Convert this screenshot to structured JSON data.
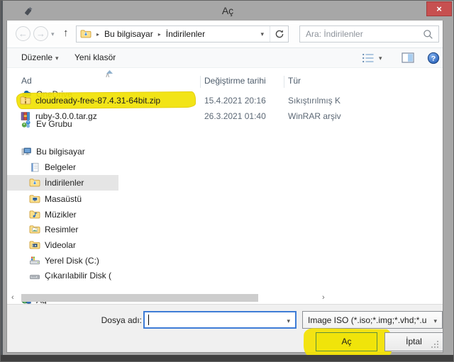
{
  "window": {
    "title": "Aç"
  },
  "icons": {
    "close": "×",
    "back": "←",
    "forward": "→",
    "up": "↑",
    "dropdown": "▾",
    "breadcrumb_sep": "▸",
    "scroll_up": "∧",
    "scroll_down": "∨",
    "scroll_left": "‹",
    "scroll_right": "›",
    "titlebar_icon": "usb-drive",
    "refresh": "refresh-arrow",
    "search": "magnifier",
    "help": "question-mark",
    "views": "list-view",
    "preview": "preview-pane"
  },
  "nav": {
    "breadcrumb": {
      "segments": [
        "Bu bilgisayar",
        "İndirilenler"
      ]
    },
    "search": {
      "placeholder": "Ara: İndirilenler"
    }
  },
  "toolbar": {
    "organize": "Düzenle",
    "new_folder": "Yeni klasör"
  },
  "sidebar": {
    "items": [
      {
        "label": "OneDrive",
        "icon": "onedrive-cloud",
        "level": 0,
        "selected": false
      },
      {
        "label": "Ev Grubu",
        "icon": "homegroup",
        "level": 0,
        "selected": false
      },
      {
        "label": "Bu bilgisayar",
        "icon": "computer",
        "level": 0,
        "selected": false
      },
      {
        "label": "Belgeler",
        "icon": "documents",
        "level": 1,
        "selected": false
      },
      {
        "label": "İndirilenler",
        "icon": "downloads-folder",
        "level": 1,
        "selected": true
      },
      {
        "label": "Masaüstü",
        "icon": "desktop-folder",
        "level": 1,
        "selected": false
      },
      {
        "label": "Müzikler",
        "icon": "music-folder",
        "level": 1,
        "selected": false
      },
      {
        "label": "Resimler",
        "icon": "pictures-folder",
        "level": 1,
        "selected": false
      },
      {
        "label": "Videolar",
        "icon": "videos-folder",
        "level": 1,
        "selected": false
      },
      {
        "label": "Yerel Disk (C:)",
        "icon": "local-disk",
        "level": 1,
        "selected": false
      },
      {
        "label": "Çıkarılabilir Disk (",
        "icon": "removable-disk",
        "level": 1,
        "selected": false
      },
      {
        "label": "Ağ",
        "icon": "network",
        "level": 0,
        "selected": false
      }
    ]
  },
  "filelist": {
    "columns": [
      "Ad",
      "Değiştirme tarihi",
      "Tür"
    ],
    "sort": {
      "column": "Ad",
      "direction": "ascending"
    },
    "rows": [
      {
        "name": "cloudready-free-87.4.31-64bit.zip",
        "date": "15.4.2021 20:16",
        "type": "Sıkıştırılmış K",
        "icon": "zip-archive",
        "highlighted": true
      },
      {
        "name": "ruby-3.0.0.tar.gz",
        "date": "26.3.2021 01:40",
        "type": "WinRAR arşiv",
        "icon": "winrar-archive",
        "highlighted": false
      }
    ]
  },
  "footer": {
    "filename_label": "Dosya adı:",
    "filename_value": "",
    "filetype_value": "Image ISO (*.iso;*.img;*.vhd;*.u",
    "open": "Aç",
    "cancel": "İptal"
  },
  "annotations": {
    "highlight_color": "#f2e206",
    "highlighted_items": [
      "cloudready-free-87.4.31-64bit.zip",
      "Aç button"
    ]
  },
  "colors": {
    "titlebar": "#a7a7a7",
    "close_button": "#c75050",
    "focus_border": "#3e7cd6",
    "selection_bg": "#e5e5e5"
  }
}
